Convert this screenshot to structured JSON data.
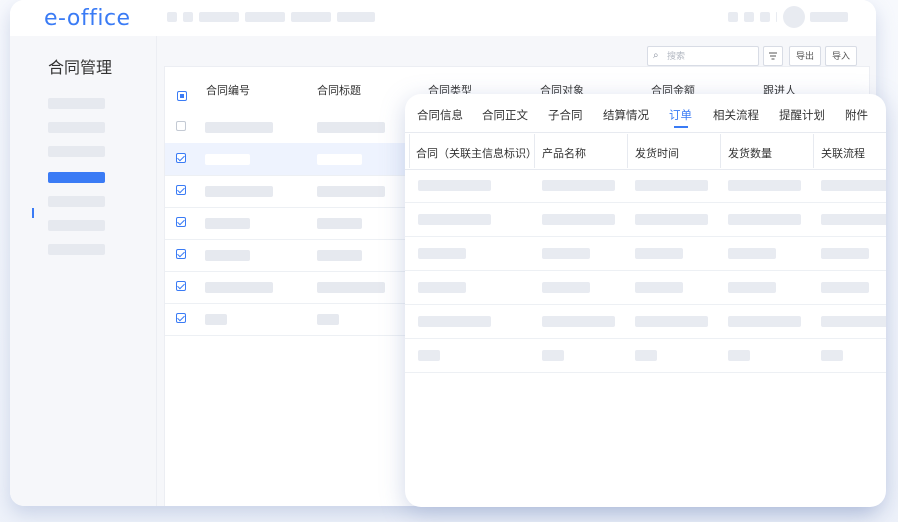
{
  "app": {
    "logo": "e-office"
  },
  "sidebar": {
    "title": "合同管理"
  },
  "toolbar": {
    "search_placeholder": "搜索",
    "search_icon": "⌕",
    "export_label": "导出",
    "import_label": "导入"
  },
  "table": {
    "columns": [
      "合同编号",
      "合同标题",
      "合同类型",
      "合同对象",
      "合同金额",
      "跟进人"
    ]
  },
  "detail": {
    "tabs": [
      "合同信息",
      "合同正文",
      "子合同",
      "结算情况",
      "订单",
      "相关流程",
      "提醒计划",
      "附件"
    ],
    "active_tab": "订单",
    "columns": [
      "合同（关联主信息标识）",
      "产品名称",
      "发货时间",
      "发货数量",
      "关联流程"
    ]
  },
  "colors": {
    "accent": "#3a7bf5",
    "placeholder": "#e8ebf1"
  }
}
